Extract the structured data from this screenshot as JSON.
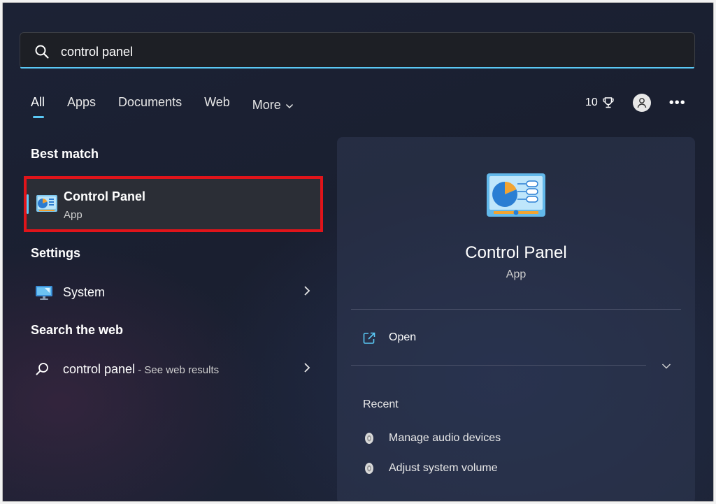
{
  "search": {
    "value": "control panel"
  },
  "tabs": [
    {
      "label": "All",
      "active": true
    },
    {
      "label": "Apps"
    },
    {
      "label": "Documents"
    },
    {
      "label": "Web"
    },
    {
      "label": "More"
    }
  ],
  "header": {
    "rewards_points": "10"
  },
  "left": {
    "best_match_title": "Best match",
    "best_match": {
      "name": "Control Panel",
      "type": "App"
    },
    "settings_title": "Settings",
    "settings_item": {
      "label": "System"
    },
    "web_title": "Search the web",
    "web_item": {
      "query": "control panel",
      "suffix": " - See web results"
    }
  },
  "detail": {
    "title": "Control Panel",
    "subtitle": "App",
    "open_label": "Open",
    "recent_title": "Recent",
    "recent_items": [
      "Manage audio devices",
      "Adjust system volume"
    ]
  },
  "colors": {
    "accent": "#5ac8f5",
    "highlight_border": "#e0141a",
    "background": "#1a1f30"
  }
}
